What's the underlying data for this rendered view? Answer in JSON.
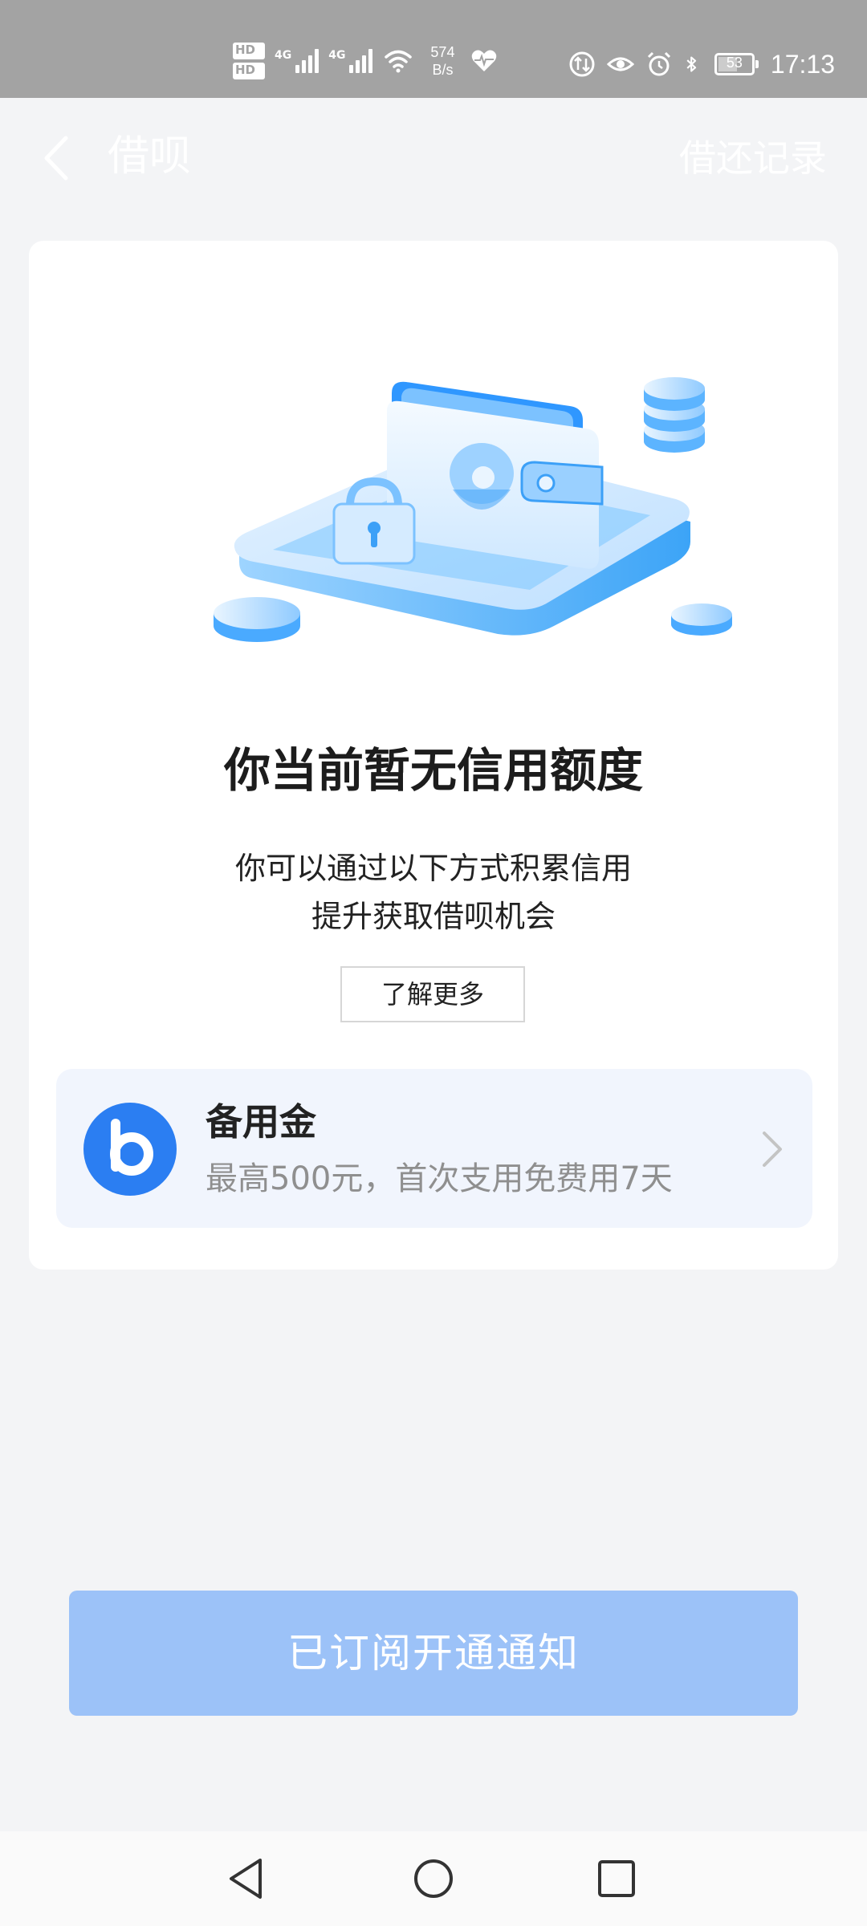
{
  "status_bar": {
    "hd1": "HD",
    "hd1_slot": "1",
    "hd2": "HD",
    "hd2_slot": "2",
    "net1": "4G",
    "net2": "4G",
    "speed_value": "574",
    "speed_unit": "B/s",
    "battery_level": "53",
    "time": "17:13"
  },
  "header": {
    "title": "借呗",
    "records_link": "借还记录"
  },
  "main": {
    "heading": "你当前暂无信用额度",
    "desc_line1": "你可以通过以下方式积累信用",
    "desc_line2": "提升获取借呗机会",
    "learn_more": "了解更多"
  },
  "reserve_fund": {
    "name": "备用金",
    "subtitle": "最高500元，首次支用免费用7天"
  },
  "subscribe_button": "已订阅开通通知",
  "colors": {
    "accent_blue": "#2b7ef2",
    "button_disabled": "#9cc2f8",
    "background": "#f3f4f6",
    "status_bar": "#a3a3a3"
  }
}
